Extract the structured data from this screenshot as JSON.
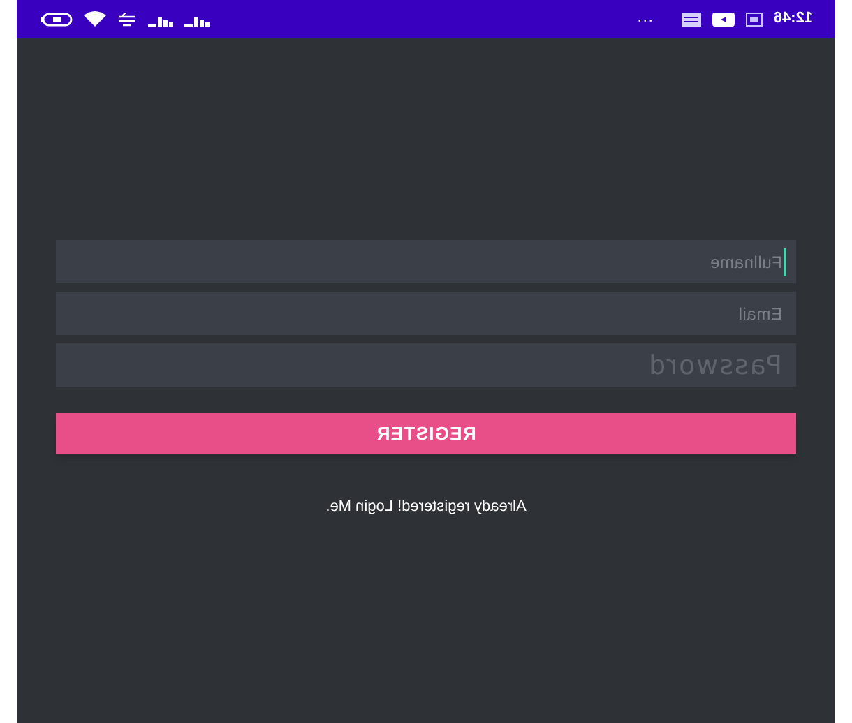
{
  "status_bar": {
    "time": "12:46",
    "more": "···"
  },
  "form": {
    "fields": [
      {
        "placeholder": "Fullname",
        "kind": "text",
        "focused": true
      },
      {
        "placeholder": "Email",
        "kind": "email",
        "focused": false
      },
      {
        "placeholder": "Password",
        "kind": "password",
        "focused": false
      }
    ],
    "register_button": "REGISTER",
    "login_link": "Already registered! Login Me."
  }
}
